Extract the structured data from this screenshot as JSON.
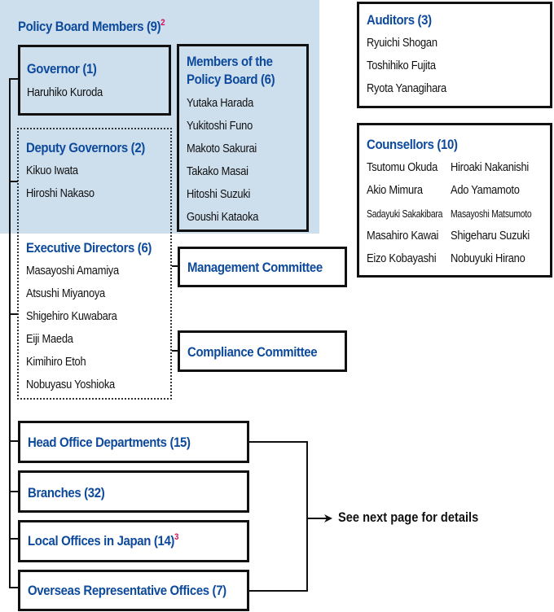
{
  "policy_board": {
    "title": "Policy Board Members (9)",
    "footnote": "2",
    "governor": {
      "title": "Governor (1)",
      "members": [
        "Haruhiko Kuroda"
      ]
    },
    "members_box": {
      "title_line1": "Members of the",
      "title_line2": "Policy Board (6)",
      "members": [
        "Yutaka Harada",
        "Yukitoshi Funo",
        "Makoto Sakurai",
        "Takako Masai",
        "Hitoshi Suzuki",
        "Goushi Kataoka"
      ]
    },
    "deputy_governors": {
      "title": "Deputy Governors (2)",
      "members": [
        "Kikuo Iwata",
        "Hiroshi Nakaso"
      ]
    }
  },
  "executive_directors": {
    "title": "Executive Directors (6)",
    "members": [
      "Masayoshi Amamiya",
      "Atsushi Miyanoya",
      "Shigehiro Kuwabara",
      "Eiji Maeda",
      "Kimihiro Etoh",
      "Nobuyasu Yoshioka"
    ]
  },
  "committees": {
    "management": "Management Committee",
    "compliance": "Compliance Committee"
  },
  "auditors": {
    "title": "Auditors (3)",
    "members": [
      "Ryuichi Shogan",
      "Toshihiko Fujita",
      "Ryota Yanagihara"
    ]
  },
  "counsellors": {
    "title": "Counsellors (10)",
    "left": [
      "Tsutomu Okuda",
      "Akio Mimura",
      "Sadayuki Sakakibara",
      "Masahiro Kawai",
      "Eizo Kobayashi"
    ],
    "right": [
      "Hiroaki Nakanishi",
      "Ado Yamamoto",
      "Masayoshi Matsumoto",
      "Shigeharu Suzuki",
      "Nobuyuki Hirano"
    ]
  },
  "units": {
    "head_office": "Head Office Departments (15)",
    "branches": "Branches (32)",
    "local_offices": "Local Offices in Japan (14)",
    "local_offices_footnote": "3",
    "overseas": "Overseas Representative Offices (7)"
  },
  "note": "See next page for details",
  "colors": {
    "title_blue": "#0d4a9c",
    "board_background": "#cddeed",
    "footnote_magenta": "#d0105c"
  }
}
